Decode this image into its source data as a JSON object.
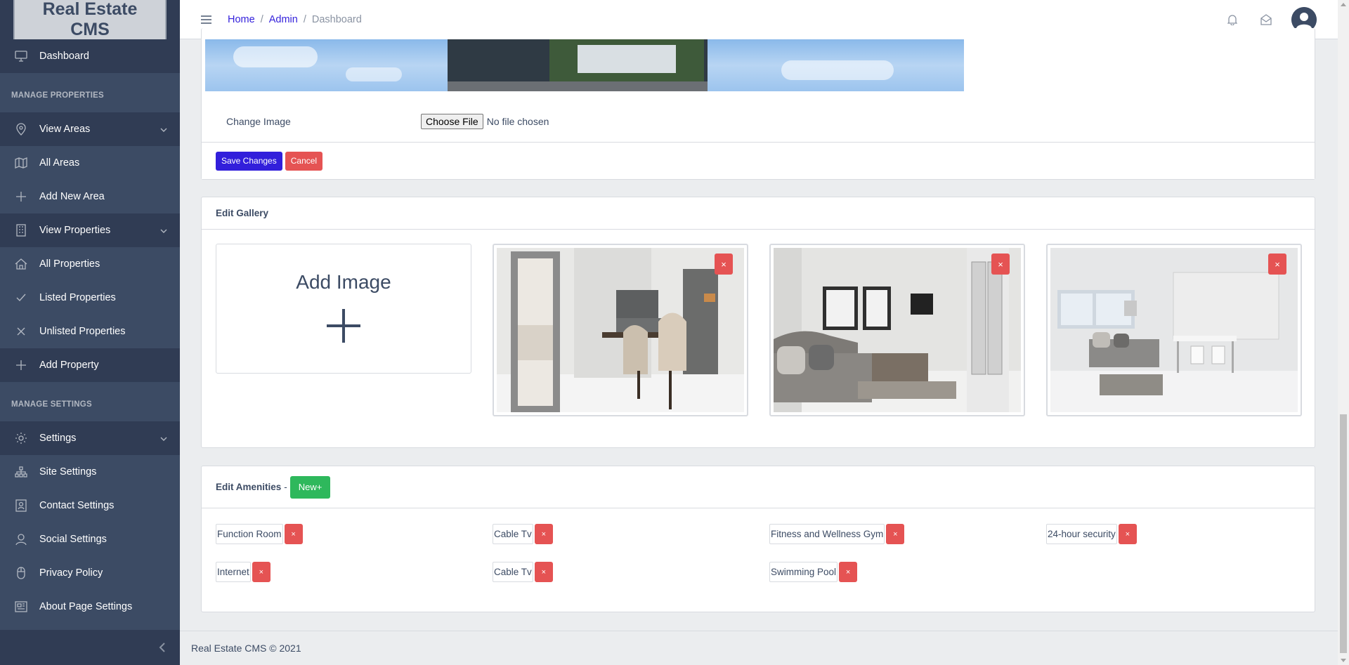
{
  "brand": "Real Estate CMS",
  "sidebar": {
    "dashboard": "Dashboard",
    "section_properties": "MANAGE PROPERTIES",
    "view_areas": "View Areas",
    "all_areas": "All Areas",
    "add_area": "Add New Area",
    "view_properties": "View Properties",
    "all_properties": "All Properties",
    "listed_properties": "Listed Properties",
    "unlisted_properties": "Unlisted Properties",
    "add_property": "Add Property",
    "section_settings": "MANAGE SETTINGS",
    "settings": "Settings",
    "site_settings": "Site Settings",
    "contact_settings": "Contact Settings",
    "social_settings": "Social Settings",
    "privacy_policy": "Privacy Policy",
    "about_settings": "About Page Settings"
  },
  "breadcrumb": {
    "home": "Home",
    "admin": "Admin",
    "current": "Dashboard",
    "sep": "/"
  },
  "form": {
    "change_image_label": "Change Image",
    "choose_file": "Choose File",
    "no_file": "No file chosen",
    "save": "Save Changes",
    "cancel": "Cancel"
  },
  "gallery": {
    "title": "Edit Gallery",
    "add_image": "Add Image",
    "remove": "×"
  },
  "amenities": {
    "title": "Edit Amenities",
    "dash": "-",
    "new_button": "New+",
    "remove": "×",
    "items": [
      "Function Room",
      "Cable Tv",
      "Fitness and Wellness Gym",
      "24-hour security",
      "Internet",
      "Cable Tv",
      "Swimming Pool"
    ]
  },
  "footer": "Real Estate CMS © 2021"
}
